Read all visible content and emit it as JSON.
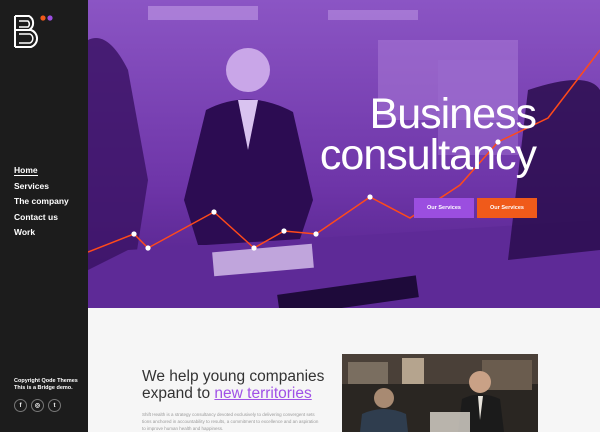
{
  "sidebar": {
    "logo_icon": "bridge-b-logo-icon",
    "nav": [
      {
        "label": "Home",
        "active": true
      },
      {
        "label": "Services",
        "active": false
      },
      {
        "label": "The company",
        "active": false
      },
      {
        "label": "Contact us",
        "active": false
      },
      {
        "label": "Work",
        "active": false
      }
    ],
    "copyright_line1": "Copyright Qode Themes",
    "copyright_line2": "This is a Bridge demo.",
    "socials": [
      {
        "icon": "facebook-icon",
        "glyph": "f"
      },
      {
        "icon": "instagram-icon",
        "glyph": "◎"
      },
      {
        "icon": "twitter-icon",
        "glyph": "t"
      }
    ]
  },
  "hero": {
    "title_line1": "Business",
    "title_line2": "consultancy",
    "button1_label": "Our Services",
    "button2_label": "Our Services",
    "colors": {
      "overlay": "#6a2fa3",
      "accent_purple": "#9b4ee0",
      "accent_orange": "#f05a1a",
      "chart_line": "#ff4a1a"
    }
  },
  "intro": {
    "heading_line1": "We help young companies",
    "heading_prefix": "expand to ",
    "heading_accent": "new territories",
    "body_line1": "Shift Health is a strategy consultancy devoted exclusively to delivering convergent sets",
    "body_line2": "tions anchored in accountability to results, a commitment to excellence and an aspiration",
    "body_line3": "to improve human health and happiness."
  }
}
